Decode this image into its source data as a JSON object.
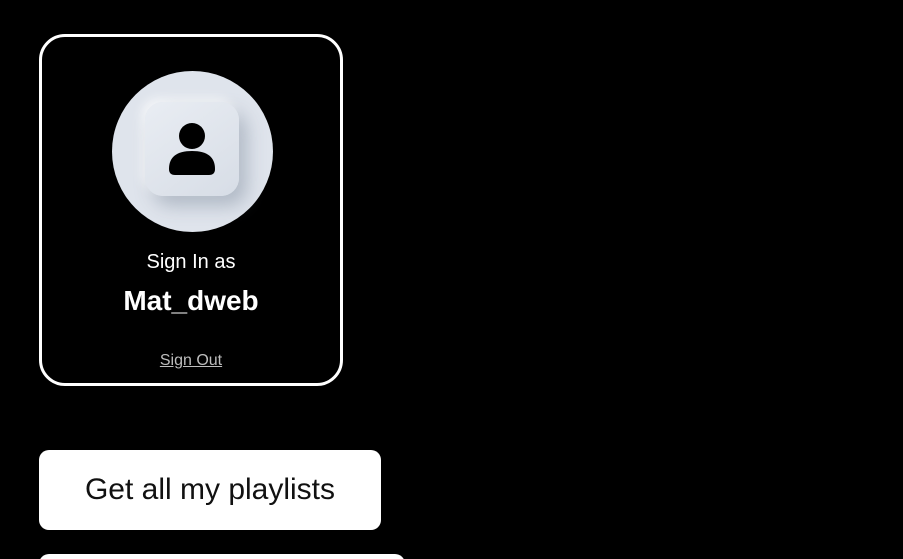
{
  "profile": {
    "signin_label": "Sign In as",
    "username": "Mat_dweb",
    "signout_label": "Sign Out",
    "avatar_icon": "user-icon"
  },
  "actions": {
    "get_playlists_label": "Get all my playlists"
  },
  "colors": {
    "background": "#000000",
    "card_border": "#ffffff",
    "avatar_bg": "#dfe4ec",
    "button_bg": "#ffffff",
    "button_text": "#111111"
  }
}
